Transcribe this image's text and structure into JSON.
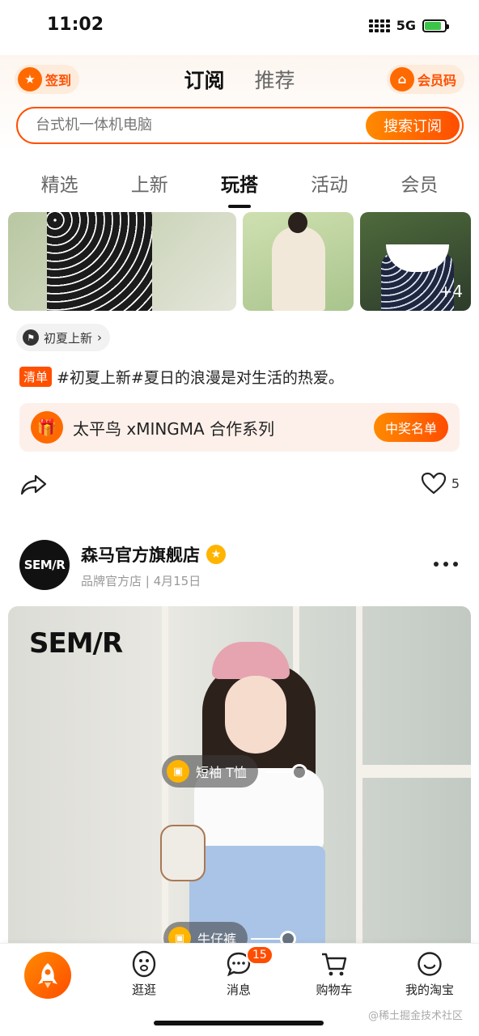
{
  "status_bar": {
    "time": "11:02",
    "network": "5G",
    "battery_level": 0.85
  },
  "header": {
    "checkin_label": "签到",
    "tabs": [
      {
        "label": "订阅",
        "active": true
      },
      {
        "label": "推荐",
        "active": false
      }
    ],
    "member_code_label": "会员码"
  },
  "search": {
    "placeholder": "台式机一体机电脑",
    "button_label": "搜索订阅"
  },
  "category_tabs": [
    {
      "label": "精选",
      "active": false
    },
    {
      "label": "上新",
      "active": false
    },
    {
      "label": "玩搭",
      "active": true
    },
    {
      "label": "活动",
      "active": false
    },
    {
      "label": "会员",
      "active": false
    }
  ],
  "post1": {
    "more_photos_label": "+4",
    "topic_tag": "初夏上新",
    "badge": "清单",
    "text": "#初夏上新#夏日的浪漫是对生活的热爱。",
    "promo": {
      "text": "太平鸟 xMINGMA 合作系列",
      "button_label": "中奖名单"
    },
    "likes": "5"
  },
  "post2": {
    "avatar_text": "SEM/R",
    "store_name": "森马官方旗舰店",
    "meta": "品牌官方店 | 4月15日",
    "brand_logo": "SEM/R",
    "product_tags": [
      {
        "label": "短袖 T恤"
      },
      {
        "label": "牛仔裤"
      }
    ]
  },
  "tabbar": {
    "items": [
      {
        "label": "逛逛"
      },
      {
        "label": "消息"
      },
      {
        "label": "购物车"
      },
      {
        "label": "我的淘宝"
      }
    ],
    "messages_badge": "15"
  },
  "watermark": "@稀土掘金技术社区",
  "colors": {
    "accent": "#ff5000",
    "accent_light": "#fdebdc"
  },
  "icons": [
    "signal-icon",
    "battery-icon",
    "checkin-icon",
    "member-code-icon",
    "flag-icon",
    "gift-icon",
    "share-icon",
    "heart-icon",
    "verified-icon",
    "more-icon",
    "shopping-bag-icon",
    "rocket-icon",
    "browse-icon",
    "message-icon",
    "cart-icon",
    "profile-icon"
  ]
}
